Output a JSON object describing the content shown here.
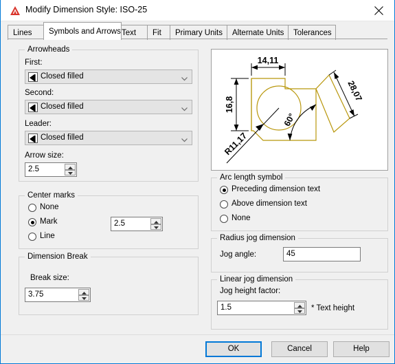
{
  "window": {
    "title": "Modify Dimension Style: ISO-25",
    "logo_icon": "autocad-logo-icon",
    "close_icon": "close-icon"
  },
  "tabs": [
    {
      "label": "Lines",
      "active": false
    },
    {
      "label": "Symbols and Arrows",
      "active": true
    },
    {
      "label": "Text",
      "active": false
    },
    {
      "label": "Fit",
      "active": false
    },
    {
      "label": "Primary Units",
      "active": false
    },
    {
      "label": "Alternate Units",
      "active": false
    },
    {
      "label": "Tolerances",
      "active": false
    }
  ],
  "arrowheads": {
    "title": "Arrowheads",
    "first_label": "First:",
    "first_value": "Closed filled",
    "second_label": "Second:",
    "second_value": "Closed filled",
    "leader_label": "Leader:",
    "leader_value": "Closed filled",
    "arrow_size_label": "Arrow size:",
    "arrow_size_value": "2.5"
  },
  "center_marks": {
    "title": "Center marks",
    "options": [
      {
        "label": "None",
        "selected": false
      },
      {
        "label": "Mark",
        "selected": true
      },
      {
        "label": "Line",
        "selected": false
      }
    ],
    "size_value": "2.5"
  },
  "dimension_break": {
    "title": "Dimension Break",
    "break_size_label": "Break size:",
    "break_size_value": "3.75"
  },
  "arc_length_symbol": {
    "title": "Arc length symbol",
    "options": [
      {
        "label": "Preceding dimension text",
        "selected": true
      },
      {
        "label": "Above dimension text",
        "selected": false
      },
      {
        "label": "None",
        "selected": false
      }
    ]
  },
  "radius_jog": {
    "title": "Radius jog dimension",
    "jog_angle_label": "Jog angle:",
    "jog_angle_value": "45"
  },
  "linear_jog": {
    "title": "Linear jog dimension",
    "jog_height_label": "Jog height factor:",
    "jog_height_value": "1.5",
    "suffix": "* Text height"
  },
  "preview": {
    "dim_width": "14,11",
    "dim_height": "16,8",
    "dim_diagonal": "28,07",
    "dim_radius": "R11,17",
    "dim_angle": "60°",
    "line_color": "#b8960a"
  },
  "footer": {
    "ok": "OK",
    "cancel": "Cancel",
    "help": "Help"
  }
}
